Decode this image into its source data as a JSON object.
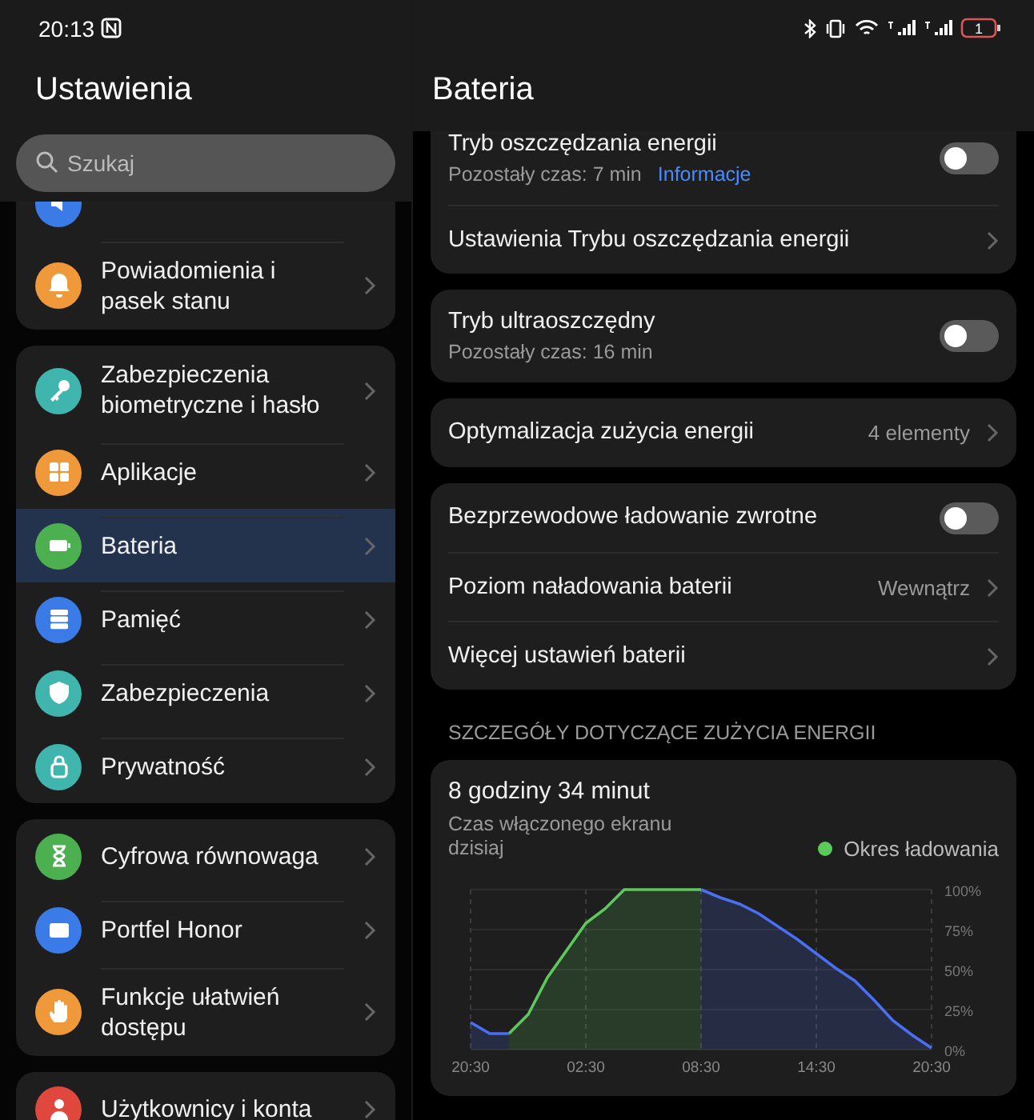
{
  "status_bar": {
    "time": "20:13",
    "battery": "1"
  },
  "left": {
    "title": "Ustawienia",
    "search": {
      "placeholder": "Szukaj"
    },
    "groups": [
      {
        "partial_icon": {
          "kind": "sound",
          "color": "#3b7be8"
        },
        "items": [
          {
            "label": "Powiadomienia i pasek stanu",
            "kind": "bell",
            "color": "#f0993a",
            "selected": false
          }
        ]
      },
      {
        "items": [
          {
            "label": "Zabezpieczenia biometryczne i hasło",
            "kind": "key",
            "color": "#3fb5ad",
            "selected": false
          },
          {
            "label": "Aplikacje",
            "kind": "grid",
            "color": "#f0993a",
            "selected": false
          },
          {
            "label": "Bateria",
            "kind": "battery",
            "color": "#4caf50",
            "selected": true
          },
          {
            "label": "Pamięć",
            "kind": "storage",
            "color": "#3b7be8",
            "selected": false
          },
          {
            "label": "Zabezpieczenia",
            "kind": "shield",
            "color": "#3fb5ad",
            "selected": false
          },
          {
            "label": "Prywatność",
            "kind": "lock",
            "color": "#3fb5ad",
            "selected": false
          }
        ]
      },
      {
        "items": [
          {
            "label": "Cyfrowa równowaga",
            "kind": "hourglass",
            "color": "#4caf50",
            "selected": false
          },
          {
            "label": "Portfel Honor",
            "kind": "wallet",
            "color": "#3b7be8",
            "selected": false
          },
          {
            "label": "Funkcje ułatwień dostępu",
            "kind": "hand",
            "color": "#f0993a",
            "selected": false
          }
        ]
      },
      {
        "items": [
          {
            "label": "Użytkownicy i konta",
            "kind": "user",
            "color": "#e0483e",
            "selected": false
          }
        ]
      }
    ]
  },
  "right": {
    "title": "Bateria",
    "groups": [
      {
        "rows": [
          {
            "kind": "toggle",
            "title": "Tryb oszczędzania energii",
            "subtitle": "Pozostały czas: 7 min",
            "link": "Informacje",
            "on": false
          },
          {
            "kind": "link",
            "title": "Ustawienia Trybu oszczędzania energii"
          }
        ]
      },
      {
        "rows": [
          {
            "kind": "toggle",
            "title": "Tryb ultraoszczędny",
            "subtitle": "Pozostały czas: 16 min",
            "on": false
          }
        ]
      },
      {
        "rows": [
          {
            "kind": "link",
            "title": "Optymalizacja zużycia energii",
            "value": "4 elementy"
          }
        ]
      },
      {
        "rows": [
          {
            "kind": "toggle",
            "title": "Bezprzewodowe ładowanie zwrotne",
            "on": false
          },
          {
            "kind": "link",
            "title": "Poziom naładowania baterii",
            "value": "Wewnątrz"
          },
          {
            "kind": "link",
            "title": "Więcej ustawień baterii"
          }
        ]
      }
    ],
    "section_heading": "SZCZEGÓŁY DOTYCZĄCE ZUŻYCIA ENERGII",
    "usage": {
      "title": "8 godziny 34 minut",
      "subtitle": "Czas włączonego ekranu dzisiaj",
      "chart_data": {
        "type": "area",
        "grid": true,
        "categories": [
          "20:30",
          null,
          null,
          null,
          null,
          null,
          "02:30",
          null,
          null,
          null,
          null,
          null,
          "08:30",
          null,
          null,
          null,
          null,
          null,
          "14:30",
          null,
          null,
          null,
          null,
          null,
          "20:30"
        ],
        "series": [
          {
            "name": "Okres ładowania",
            "color": "#5cc95c",
            "values": [
              null,
              null,
              10,
              22,
              45,
              62,
              79,
              88,
              100,
              100,
              100,
              100,
              100,
              null,
              null,
              null,
              null,
              null,
              null,
              null,
              null,
              null,
              null,
              null,
              null
            ]
          },
          {
            "color": "#4a6ff0",
            "values": [
              17,
              10,
              10,
              null,
              null,
              null,
              null,
              null,
              null,
              null,
              null,
              null,
              100,
              95,
              91,
              85,
              77,
              69,
              60,
              51,
              43,
              31,
              18,
              9,
              1
            ]
          }
        ],
        "ylim": [
          0,
          100
        ],
        "yticks": [
          {
            "value": 0,
            "label": "0%"
          },
          {
            "value": 25,
            "label": "25%"
          },
          {
            "value": 50,
            "label": "50%"
          },
          {
            "value": 75,
            "label": "75%"
          },
          {
            "value": 100,
            "label": "100%"
          }
        ]
      }
    }
  }
}
